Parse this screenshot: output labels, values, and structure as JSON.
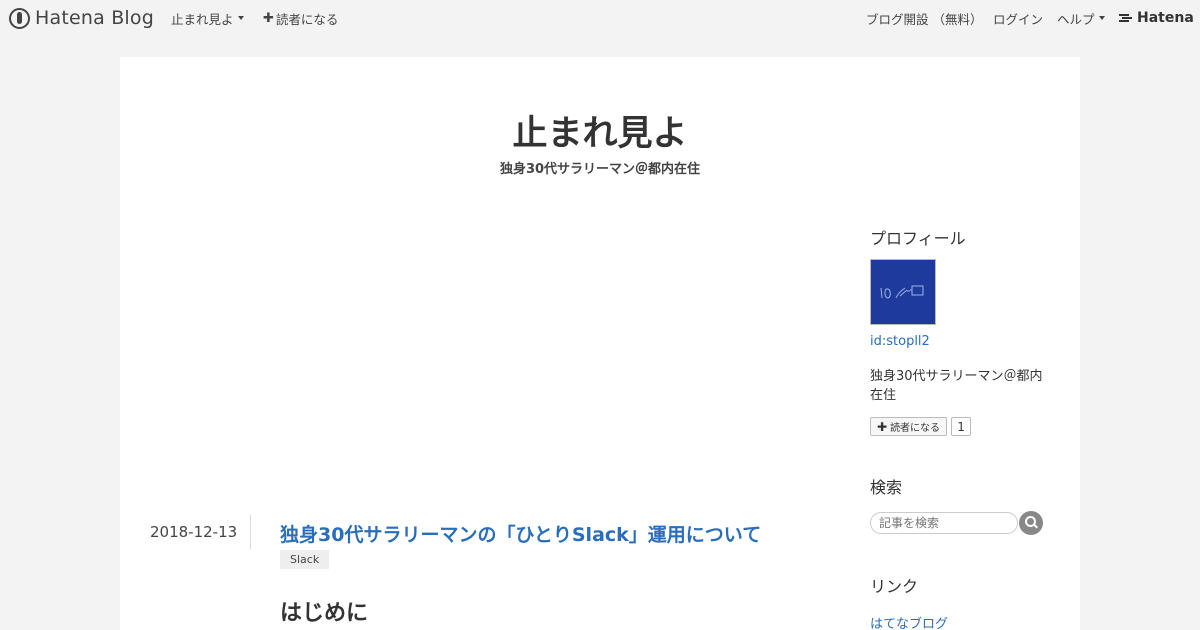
{
  "globalbar": {
    "logo": "Hatena Blog",
    "blog_menu": "止まれ見よ",
    "subscribe": "読者になる",
    "open_blog": "ブログ開設 （無料）",
    "login": "ログイン",
    "help": "ヘルプ",
    "brand": "Hatena"
  },
  "blog": {
    "title": "止まれ見よ",
    "description": "独身30代サラリーマン＠都内在住"
  },
  "sidebar": {
    "profile_title": "プロフィール",
    "profile_id": "id:stopll2",
    "profile_desc": "独身30代サラリーマン＠都内在住",
    "subscribe_label": "読者になる",
    "subscribe_count": "1",
    "search_title": "検索",
    "search_placeholder": "記事を検索",
    "link_title": "リンク",
    "links": [
      "はてなブログ"
    ]
  },
  "entry": {
    "date": "2018-12-13",
    "title": "独身30代サラリーマンの「ひとりSlack」運用について",
    "tag": "Slack",
    "heading": "はじめに"
  },
  "colors": {
    "link": "#2a6ebb",
    "avatar_bg": "#1d3a9c"
  }
}
